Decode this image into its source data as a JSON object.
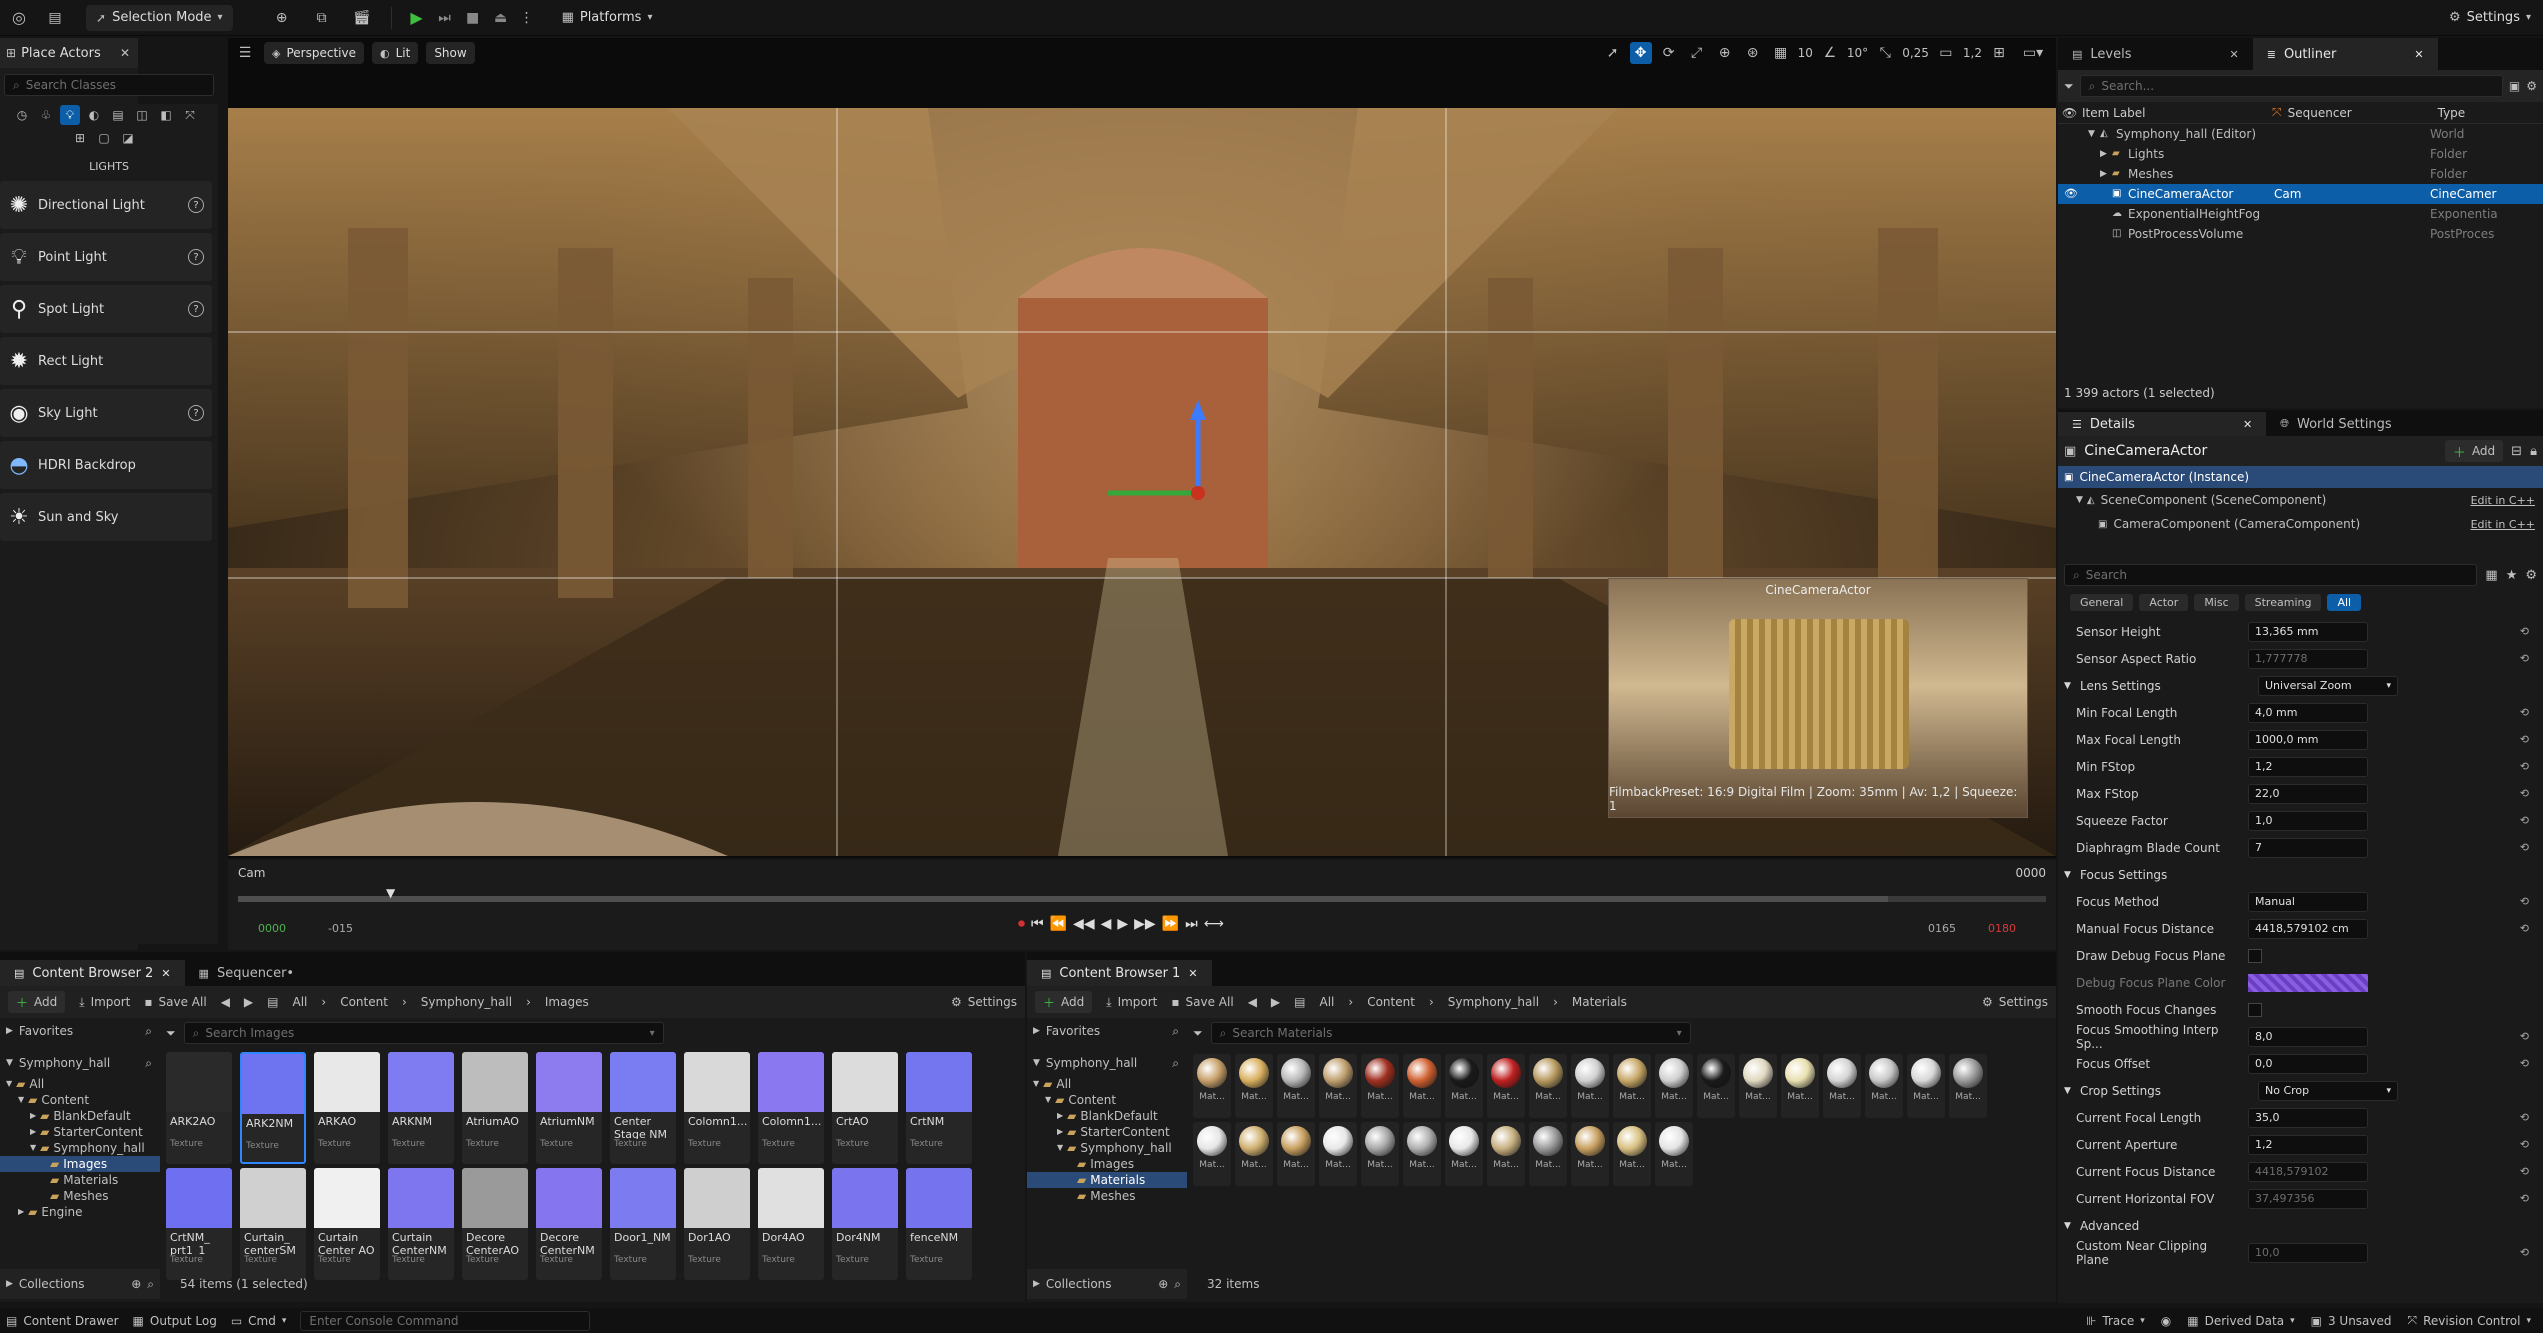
{
  "toolbar": {
    "mode": "Selection Mode",
    "platforms": "Platforms",
    "settings": "Settings"
  },
  "place_actors": {
    "title": "Place Actors",
    "search_placeholder": "Search Classes",
    "category": "LIGHTS",
    "items": [
      "Directional Light",
      "Point Light",
      "Spot Light",
      "Rect Light",
      "Sky Light",
      "HDRI Backdrop",
      "Sun and Sky"
    ]
  },
  "viewport": {
    "perspective": "Perspective",
    "lit": "Lit",
    "show": "Show",
    "grid_snap": "10",
    "angle_snap": "10°",
    "scale_snap": "0,25",
    "cam_speed": "1,2",
    "cam_label": "CineCameraActor",
    "cam_info": "FilmbackPreset: 16:9 Digital Film | Zoom: 35mm | Av: 1,2 | Squeeze: 1"
  },
  "sequencer": {
    "track": "Cam",
    "frame_right": "0000",
    "start": "0000",
    "start_neg": "-015",
    "end": "0165",
    "end_red": "0180"
  },
  "outliner": {
    "tabs": [
      "Levels",
      "Outliner"
    ],
    "search_placeholder": "Search...",
    "col_label": "Item Label",
    "col_sequencer": "Sequencer",
    "col_type": "Type",
    "rows": [
      {
        "label": "Symphony_hall (Editor)",
        "seq": "",
        "type": "World"
      },
      {
        "label": "Lights",
        "seq": "",
        "type": "Folder"
      },
      {
        "label": "Meshes",
        "seq": "",
        "type": "Folder"
      },
      {
        "label": "CineCameraActor",
        "seq": "Cam",
        "type": "CineCamer"
      },
      {
        "label": "ExponentialHeightFog",
        "seq": "",
        "type": "Exponentia"
      },
      {
        "label": "PostProcessVolume",
        "seq": "",
        "type": "PostProces"
      }
    ],
    "status": "1 399 actors (1 selected)"
  },
  "details": {
    "tabs": [
      "Details",
      "World Settings"
    ],
    "actor": "CineCameraActor",
    "add": "Add",
    "instance": "CineCameraActor (Instance)",
    "scene_comp": "SceneComponent (SceneComponent)",
    "camera_comp": "CameraComponent (CameraComponent)",
    "edit_cpp": "Edit in C++",
    "search_placeholder": "Search",
    "filters": [
      "General",
      "Actor",
      "Misc",
      "Streaming",
      "All"
    ],
    "props": [
      {
        "type": "prop",
        "name": "Sensor Height",
        "value": "13,365 mm",
        "dim": false
      },
      {
        "type": "prop",
        "name": "Sensor Aspect Ratio",
        "value": "1,777778",
        "dim": true
      },
      {
        "type": "section",
        "name": "Lens Settings",
        "value": "Universal Zoom"
      },
      {
        "type": "prop",
        "name": "Min Focal Length",
        "value": "4,0 mm",
        "dim": false
      },
      {
        "type": "prop",
        "name": "Max Focal Length",
        "value": "1000,0 mm",
        "dim": false
      },
      {
        "type": "prop",
        "name": "Min FStop",
        "value": "1,2",
        "dim": false
      },
      {
        "type": "prop",
        "name": "Max FStop",
        "value": "22,0",
        "dim": false
      },
      {
        "type": "prop",
        "name": "Squeeze Factor",
        "value": "1,0",
        "dim": false
      },
      {
        "type": "prop",
        "name": "Diaphragm Blade Count",
        "value": "7",
        "dim": false
      },
      {
        "type": "section",
        "name": "Focus Settings",
        "value": ""
      },
      {
        "type": "prop",
        "name": "Focus Method",
        "value": "Manual",
        "dim": false
      },
      {
        "type": "prop",
        "name": "Manual Focus Distance",
        "value": "4418,579102 cm",
        "dim": false
      },
      {
        "type": "check",
        "name": "Draw Debug Focus Plane",
        "value": ""
      },
      {
        "type": "color",
        "name": "Debug Focus Plane Color",
        "value": ""
      },
      {
        "type": "check",
        "name": "Smooth Focus Changes",
        "value": ""
      },
      {
        "type": "prop",
        "name": "Focus Smoothing Interp Sp...",
        "value": "8,0",
        "dim": false
      },
      {
        "type": "prop",
        "name": "Focus Offset",
        "value": "0,0",
        "dim": false
      },
      {
        "type": "section",
        "name": "Crop Settings",
        "value": "No Crop"
      },
      {
        "type": "prop",
        "name": "Current Focal Length",
        "value": "35,0",
        "dim": false
      },
      {
        "type": "prop",
        "name": "Current Aperture",
        "value": "1,2",
        "dim": false
      },
      {
        "type": "prop",
        "name": "Current Focus Distance",
        "value": "4418,579102",
        "dim": true
      },
      {
        "type": "prop",
        "name": "Current Horizontal FOV",
        "value": "37,497356",
        "dim": true
      },
      {
        "type": "section",
        "name": "Advanced",
        "value": ""
      },
      {
        "type": "prop",
        "name": "Custom Near Clipping Plane",
        "value": "10,0",
        "dim": true
      }
    ]
  },
  "content_browser_2": {
    "tab": "Content Browser 2",
    "tab2": "Sequencer•",
    "add": "Add",
    "import": "Import",
    "save_all": "Save All",
    "settings": "Settings",
    "path": [
      "All",
      "Content",
      "Symphony_hall",
      "Images"
    ],
    "favorites": "Favorites",
    "root": "Symphony_hall",
    "search_placeholder": "Search Images",
    "tree": [
      "All",
      "Content",
      "BlankDefault",
      "StarterContent",
      "Symphony_hall",
      "Images",
      "Materials",
      "Meshes",
      "Engine"
    ],
    "assets": [
      {
        "name": "ARK2AO",
        "color": "#2a2a2a"
      },
      {
        "name": "ARK2NM",
        "color": "#6e74f0"
      },
      {
        "name": "ARKAO",
        "color": "#e8e8e8"
      },
      {
        "name": "ARKNM",
        "color": "#7e7cf0"
      },
      {
        "name": "AtriumAO",
        "color": "#bdbdbd"
      },
      {
        "name": "AtriumNM",
        "color": "#8d7bf0"
      },
      {
        "name": "Center Stage NM",
        "color": "#7a7df2"
      },
      {
        "name": "Colomn1...",
        "color": "#d9d9d9"
      },
      {
        "name": "Colomn1...",
        "color": "#8a78f0"
      },
      {
        "name": "CrtAO",
        "color": "#dcdcdc"
      },
      {
        "name": "CrtNM",
        "color": "#7476f0"
      },
      {
        "name": "CrtNM_ prt1_1",
        "color": "#6f6ff2"
      },
      {
        "name": "Curtain_ centerSM",
        "color": "#d0d0d0"
      },
      {
        "name": "Curtain Center AO",
        "color": "#f0f0f0"
      },
      {
        "name": "Curtain CenterNM",
        "color": "#7d76ee"
      },
      {
        "name": "Decore CenterAO",
        "color": "#9a9a9a"
      },
      {
        "name": "Decore CenterNM",
        "color": "#8576ef"
      },
      {
        "name": "Door1_NM",
        "color": "#7c7cf0"
      },
      {
        "name": "Dor1AO",
        "color": "#cfcfcf"
      },
      {
        "name": "Dor4AO",
        "color": "#e0e0e0"
      },
      {
        "name": "Dor4NM",
        "color": "#7a75ee"
      },
      {
        "name": "fenceNM",
        "color": "#7574ee"
      }
    ],
    "asset_type": "Texture",
    "collections": "Collections",
    "status": "54 items (1 selected)"
  },
  "content_browser_1": {
    "tab": "Content Browser 1",
    "add": "Add",
    "import": "Import",
    "save_all": "Save All",
    "settings": "Settings",
    "path": [
      "All",
      "Content",
      "Symphony_hall",
      "Materials"
    ],
    "favorites": "Favorites",
    "root": "Symphony_hall",
    "search_placeholder": "Search Materials",
    "tree": [
      "All",
      "Content",
      "BlankDefault",
      "StarterContent",
      "Symphony_hall",
      "Images",
      "Materials",
      "Meshes"
    ],
    "materials_row1": [
      "#c8a06a",
      "#d9b060",
      "#b8b8b8",
      "#c0a070",
      "#a03020",
      "#d06030",
      "#1a1a1a",
      "#c02020",
      "#b89a60",
      "#d0d0d0",
      "#c8a868",
      "#cfcfcf",
      "#1a1a1a",
      "#e0d8c0",
      "#e8e0b0",
      "#d4d4d4",
      "#c8c8c8",
      "#d8d8d8",
      "#9a9a9a"
    ],
    "materials_row2": [
      "#e6e6e6",
      "#d0b070",
      "#c8a060",
      "#e8e8e8",
      "#a8a8a8",
      "#b0b0b0",
      "#e8e8e8",
      "#c8b080",
      "#9a9a9a",
      "#c8a060",
      "#d8c080",
      "#e4e4e4"
    ],
    "mat_label": "Mat...",
    "collections": "Collections",
    "status": "32 items"
  },
  "statusbar": {
    "content_drawer": "Content Drawer",
    "output_log": "Output Log",
    "cmd": "Cmd",
    "console_placeholder": "Enter Console Command",
    "trace": "Trace",
    "derived": "Derived Data",
    "unsaved": "3 Unsaved",
    "revision": "Revision Control"
  }
}
